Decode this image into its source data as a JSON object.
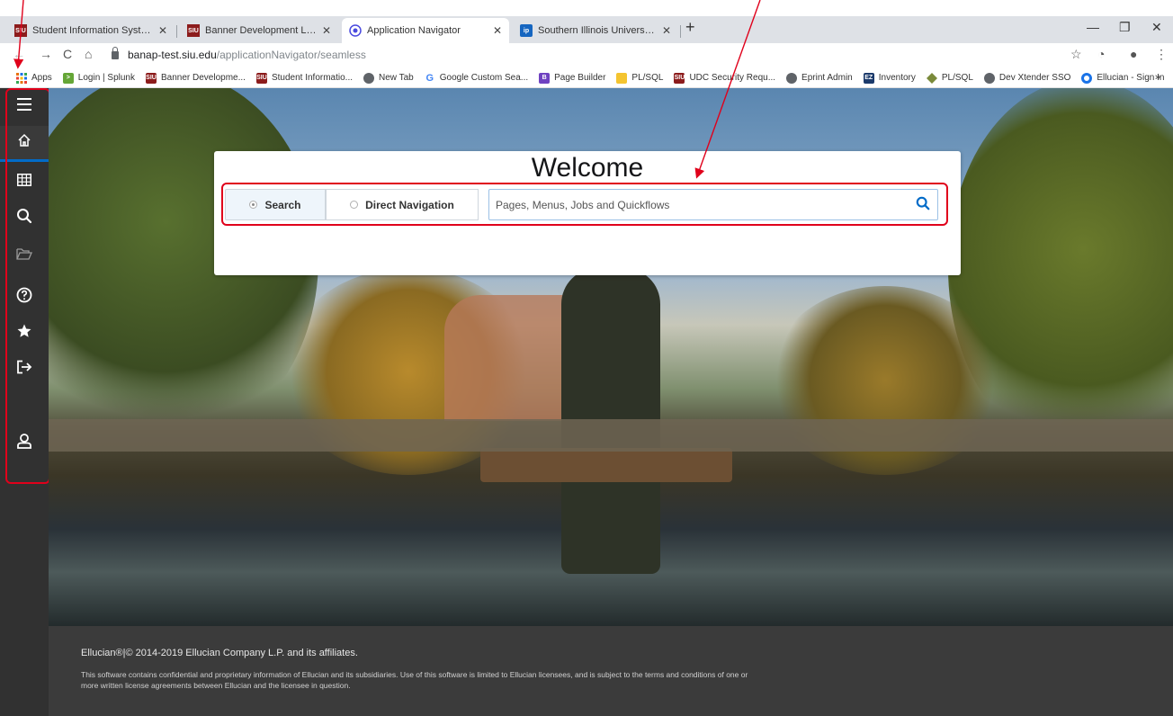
{
  "browser": {
    "tabs": [
      {
        "title": "Student Information System | Sou",
        "favicon": "siu-logo-icon",
        "active": false
      },
      {
        "title": "Banner Development Links",
        "favicon": "siu-logo-icon",
        "active": false
      },
      {
        "title": "Application Navigator",
        "favicon": "ellucian-logo-icon",
        "active": true
      },
      {
        "title": "Southern Illinois University: Taylo",
        "favicon": "ip-logo-icon",
        "active": false
      }
    ],
    "favicon_text": {
      "siu": "SIU",
      "ip": "ip"
    },
    "url_host": "banap-test.siu.edu",
    "url_path": "/applicationNavigator/seamless",
    "bookmarks": [
      {
        "label": "Apps",
        "icon": "apps-grid-icon"
      },
      {
        "label": "Login | Splunk",
        "icon": "splunk-icon"
      },
      {
        "label": "Banner Developme...",
        "icon": "siu-logo-icon"
      },
      {
        "label": "Student Informatio...",
        "icon": "siu-logo-icon"
      },
      {
        "label": "New Tab",
        "icon": "globe-icon"
      },
      {
        "label": "Google Custom Sea...",
        "icon": "google-icon"
      },
      {
        "label": "Page Builder",
        "icon": "page-builder-icon"
      },
      {
        "label": "PL/SQL",
        "icon": "folder-icon"
      },
      {
        "label": "UDC Security Requ...",
        "icon": "siu-logo-icon"
      },
      {
        "label": "Eprint Admin",
        "icon": "globe-icon"
      },
      {
        "label": "Inventory",
        "icon": "ez-icon"
      },
      {
        "label": "PL/SQL",
        "icon": "diamond-icon"
      },
      {
        "label": "Dev Xtender SSO",
        "icon": "globe-icon"
      },
      {
        "label": "Ellucian - Sign In",
        "icon": "ellucian-circle-icon"
      }
    ],
    "bookmark_icon_text": {
      "siu": "SIU",
      "ez": "EZ",
      "google": "G",
      "page_builder": "B"
    }
  },
  "sidebar": {
    "items": [
      {
        "name": "menu",
        "icon": "hamburger-icon"
      },
      {
        "name": "home",
        "icon": "home-icon"
      },
      {
        "name": "applications",
        "icon": "grid-icon"
      },
      {
        "name": "search",
        "icon": "search-icon"
      },
      {
        "name": "recent",
        "icon": "folder-open-icon"
      },
      {
        "name": "help",
        "icon": "question-circle-icon"
      },
      {
        "name": "favorites",
        "icon": "star-icon"
      },
      {
        "name": "sign-out",
        "icon": "sign-out-icon"
      },
      {
        "name": "user-profile",
        "icon": "user-icon"
      }
    ]
  },
  "welcome": {
    "title": "Welcome",
    "search_label": "Search",
    "direct_nav_label": "Direct Navigation",
    "search_placeholder": "Pages, Menus, Jobs and Quickflows"
  },
  "footer": {
    "copyright": "Ellucian®|© 2014-2019 Ellucian Company L.P. and its affiliates.",
    "legal": "This software contains confidential and proprietary information of Ellucian and its subsidiaries. Use of this software is limited to Ellucian licensees, and is subject to the terms and conditions of one or more written license agreements between Ellucian and the licensee in question."
  },
  "colors": {
    "sidebar_bg": "#313131",
    "accent_blue": "#026bc8",
    "annotation_red": "#e0001b",
    "footer_bg": "#3b3b3b"
  }
}
